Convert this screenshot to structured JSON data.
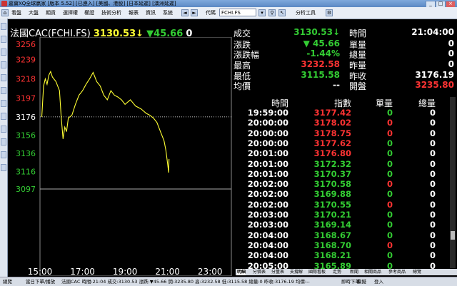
{
  "window": {
    "title": "嘉實XQ全球贏家 [版本 5.52] [已連入] [美國、港股] [日本延遲] [澳洲延遲]",
    "min": "_",
    "max": "□",
    "close": "×"
  },
  "toolbar": {
    "menus": [
      "看盤",
      "大盤",
      "期貨",
      "選擇權",
      "權證",
      "技術分析",
      "報表",
      "資訊",
      "系統"
    ],
    "code_label": "代碼",
    "code_value": "FCHI.FS",
    "analysis_label": "分析工具"
  },
  "chart": {
    "instrument": "法國CAC(FCHI.FS)",
    "price": "3130.53↓",
    "change": "▼45.66",
    "volume": "0",
    "y_labels": [
      "3256",
      "3239",
      "3218",
      "3197",
      "3176",
      "3156",
      "3136",
      "3116",
      "3097"
    ],
    "x_labels": [
      "15:00",
      "17:00",
      "19:00",
      "21:00",
      "23:00"
    ]
  },
  "chart_data": {
    "type": "line",
    "x_range": [
      "15:00",
      "24:00"
    ],
    "ylim": [
      3097,
      3256
    ],
    "y_ticks": [
      3256,
      3239,
      3218,
      3197,
      3176,
      3156,
      3136,
      3116,
      3097
    ],
    "reference_line": 3176.19,
    "series": [
      {
        "points": [
          [
            "15:05",
            3176
          ],
          [
            "15:10",
            3210
          ],
          [
            "15:15",
            3218
          ],
          [
            "15:20",
            3212
          ],
          [
            "15:25",
            3222
          ],
          [
            "15:30",
            3226
          ],
          [
            "15:35",
            3220
          ],
          [
            "15:45",
            3215
          ],
          [
            "15:55",
            3205
          ],
          [
            "16:00",
            3175
          ],
          [
            "16:05",
            3152
          ],
          [
            "16:10",
            3165
          ],
          [
            "16:15",
            3160
          ],
          [
            "16:20",
            3175
          ],
          [
            "16:30",
            3178
          ],
          [
            "16:40",
            3190
          ],
          [
            "16:50",
            3200
          ],
          [
            "17:00",
            3205
          ],
          [
            "17:10",
            3212
          ],
          [
            "17:20",
            3218
          ],
          [
            "17:30",
            3225
          ],
          [
            "17:40",
            3215
          ],
          [
            "17:50",
            3210
          ],
          [
            "18:00",
            3200
          ],
          [
            "18:10",
            3195
          ],
          [
            "18:20",
            3205
          ],
          [
            "18:30",
            3200
          ],
          [
            "18:40",
            3198
          ],
          [
            "18:50",
            3195
          ],
          [
            "19:00",
            3190
          ],
          [
            "19:15",
            3195
          ],
          [
            "19:30",
            3188
          ],
          [
            "19:45",
            3185
          ],
          [
            "20:00",
            3180
          ],
          [
            "20:10",
            3178
          ],
          [
            "20:20",
            3175
          ],
          [
            "20:30",
            3170
          ],
          [
            "20:40",
            3160
          ],
          [
            "20:50",
            3150
          ],
          [
            "20:55",
            3140
          ],
          [
            "21:00",
            3125
          ],
          [
            "21:03",
            3115
          ],
          [
            "21:04",
            3130
          ]
        ]
      }
    ]
  },
  "quote": {
    "labels": {
      "trade": "成交",
      "change": "漲跌",
      "change_pct": "漲跌幅",
      "high": "最高",
      "low": "最低",
      "avg": "均價",
      "time": "時間",
      "unit_vol": "單量",
      "total_vol": "總量",
      "prev_vol": "昨量",
      "prev_close": "昨收",
      "open": "開盤"
    },
    "values": {
      "trade": "3130.53↓",
      "change": "▼ 45.66",
      "change_pct": "-1.44%",
      "high": "3232.58",
      "low": "3115.58",
      "avg": "--",
      "time": "21:04:00",
      "unit_vol": "0",
      "total_vol": "0",
      "prev_vol": "0",
      "prev_close": "3176.19",
      "open": "3235.80"
    }
  },
  "ticks": {
    "headers": [
      "時間",
      "指數",
      "單量",
      "總量"
    ],
    "rows": [
      {
        "time": "19:59:00",
        "index": "3177.42",
        "unit": "0",
        "total": "0",
        "ic": "#ff3333",
        "uc": "#33cc33"
      },
      {
        "time": "20:00:00",
        "index": "3178.02",
        "unit": "0",
        "total": "0",
        "ic": "#ff3333",
        "uc": "#ff3333"
      },
      {
        "time": "20:00:00",
        "index": "3178.75",
        "unit": "0",
        "total": "0",
        "ic": "#ff3333",
        "uc": "#ff3333"
      },
      {
        "time": "20:00:00",
        "index": "3177.62",
        "unit": "0",
        "total": "0",
        "ic": "#ff3333",
        "uc": "#33cc33"
      },
      {
        "time": "20:01:00",
        "index": "3176.80",
        "unit": "0",
        "total": "0",
        "ic": "#ff3333",
        "uc": "#33cc33"
      },
      {
        "time": "20:01:00",
        "index": "3172.32",
        "unit": "0",
        "total": "0",
        "ic": "#33cc33",
        "uc": "#33cc33"
      },
      {
        "time": "20:01:00",
        "index": "3170.37",
        "unit": "0",
        "total": "0",
        "ic": "#33cc33",
        "uc": "#33cc33"
      },
      {
        "time": "20:02:00",
        "index": "3170.58",
        "unit": "0",
        "total": "0",
        "ic": "#33cc33",
        "uc": "#ff3333"
      },
      {
        "time": "20:02:00",
        "index": "3169.88",
        "unit": "0",
        "total": "0",
        "ic": "#33cc33",
        "uc": "#33cc33"
      },
      {
        "time": "20:02:00",
        "index": "3170.55",
        "unit": "0",
        "total": "0",
        "ic": "#33cc33",
        "uc": "#ff3333"
      },
      {
        "time": "20:03:00",
        "index": "3170.21",
        "unit": "0",
        "total": "0",
        "ic": "#33cc33",
        "uc": "#33cc33"
      },
      {
        "time": "20:03:00",
        "index": "3169.14",
        "unit": "0",
        "total": "0",
        "ic": "#33cc33",
        "uc": "#33cc33"
      },
      {
        "time": "20:04:00",
        "index": "3168.67",
        "unit": "0",
        "total": "0",
        "ic": "#33cc33",
        "uc": "#33cc33"
      },
      {
        "time": "20:04:00",
        "index": "3168.70",
        "unit": "0",
        "total": "0",
        "ic": "#33cc33",
        "uc": "#ff3333"
      },
      {
        "time": "20:04:00",
        "index": "3168.21",
        "unit": "0",
        "total": "0",
        "ic": "#33cc33",
        "uc": "#33cc33"
      },
      {
        "time": "20:05:00",
        "index": "3165.89",
        "unit": "0",
        "total": "0",
        "ic": "#33cc33",
        "uc": "#33cc33"
      }
    ]
  },
  "tabs": [
    "明細",
    "分價表",
    "分量表",
    "支撐解",
    "國際看板",
    "走勢",
    "新聞",
    "相關商品",
    "參考商品",
    "總覽"
  ],
  "status": {
    "left": "總覽",
    "ticker": "當日下單/播放",
    "info": "法國CAC 時間:21:04 成交:3130.53 漲跌:▼45.66 開:3235.80 高:3232.58 低:3115.58 總量:0 昨收:3176.19 均價:--",
    "right1": "即時下單",
    "right2": "模擬",
    "right3": "登入"
  },
  "colors": {
    "up": "#ff3333",
    "down": "#33cc33",
    "line": "#ffff33",
    "white": "#ffffff"
  }
}
